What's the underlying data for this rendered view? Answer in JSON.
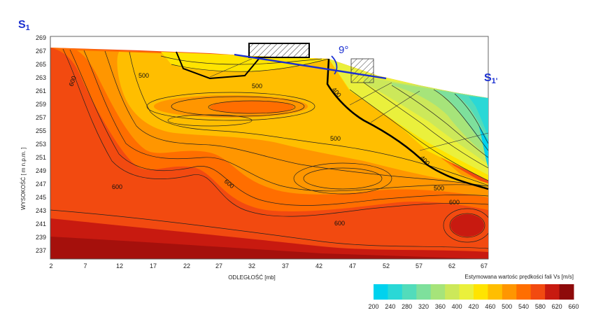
{
  "labels": {
    "section_left": "S",
    "section_left_sub": "1",
    "section_right": "S",
    "section_right_sub": "1'",
    "dip_angle": "9°",
    "y_axis": "WYSOKOŚĆ [ m n.p.m. ]",
    "x_axis": "ODLEGŁOŚĆ [mb]",
    "legend_title": "Estymowana wartośc prędkości fali Vs [m/s]"
  },
  "axes": {
    "y_ticks": [
      "269",
      "267",
      "265",
      "263",
      "261",
      "259",
      "257",
      "255",
      "253",
      "251",
      "249",
      "247",
      "245",
      "243",
      "241",
      "239",
      "237"
    ],
    "x_ticks": [
      "2",
      "7",
      "12",
      "17",
      "22",
      "27",
      "32",
      "37",
      "42",
      "47",
      "52",
      "57",
      "62",
      "67"
    ]
  },
  "contour_labels": [
    "600",
    "500",
    "500",
    "400",
    "500",
    "600",
    "600",
    "400",
    "500",
    "600",
    "600"
  ],
  "legend": {
    "values": [
      "200",
      "240",
      "280",
      "320",
      "360",
      "400",
      "420",
      "460",
      "500",
      "540",
      "580",
      "620",
      "660"
    ],
    "colors": [
      "#00d2ee",
      "#2ad8d6",
      "#52dcbb",
      "#7ee09c",
      "#a6e47a",
      "#cce85a",
      "#eaf03c",
      "#ffe400",
      "#ffbe00",
      "#ff9600",
      "#ff6e00",
      "#f24a10",
      "#c81a10",
      "#8e0a0a"
    ]
  },
  "colors": {
    "section_label": "#1a2fd1",
    "fault_line": "#1a2fd1"
  }
}
